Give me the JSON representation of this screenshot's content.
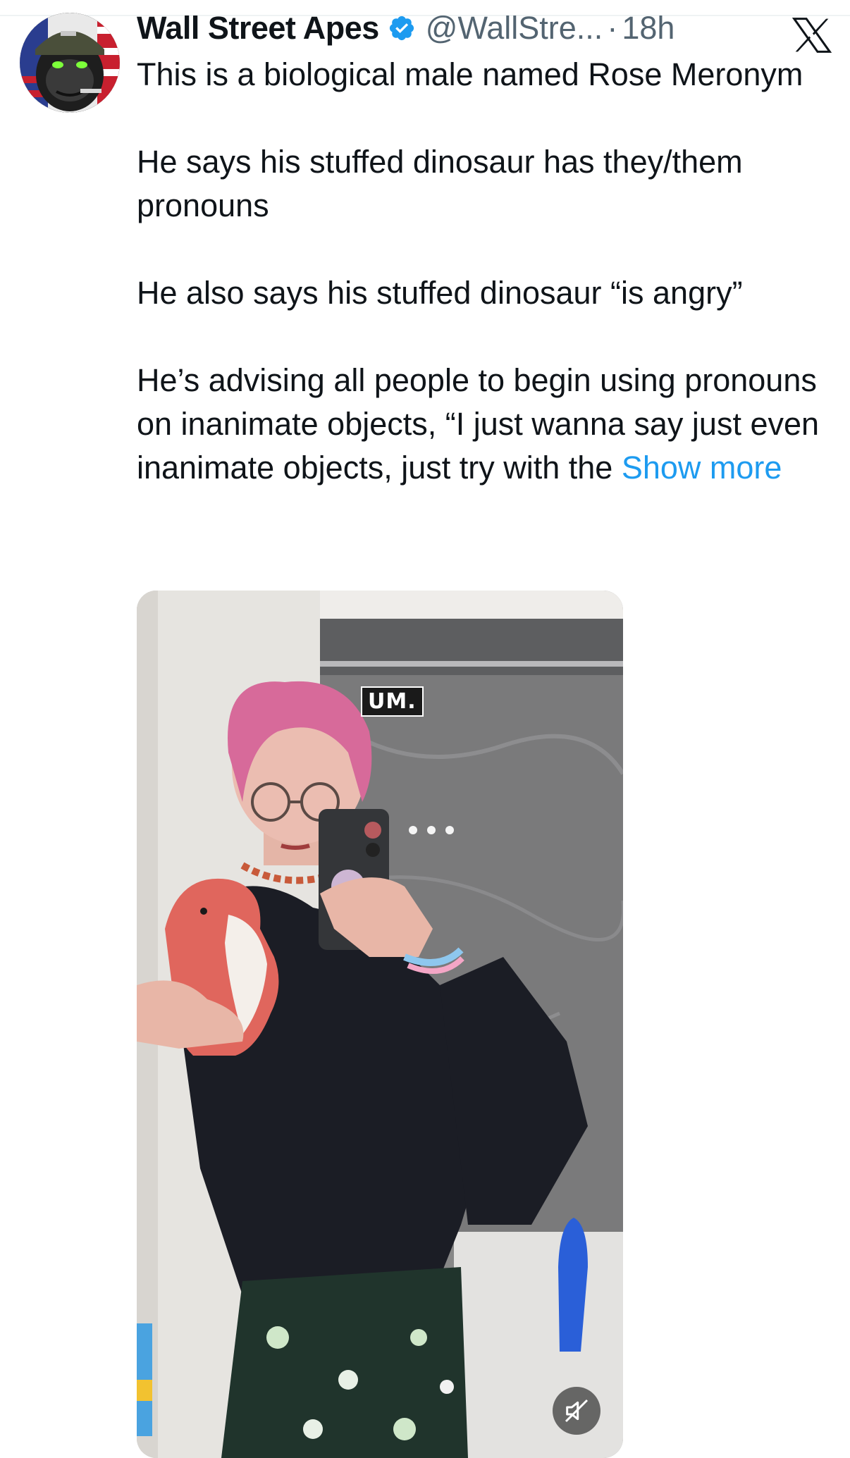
{
  "tweet": {
    "author": {
      "display_name": "Wall Street Apes",
      "handle": "@WallStre...",
      "verified": true
    },
    "separator": "·",
    "timestamp": "18h",
    "paragraphs": [
      "This is a biological male named Rose Meronym",
      "He says his stuffed dinosaur has they/them pronouns",
      "He also says his stuffed dinosaur “is angry”"
    ],
    "last_paragraph": "He’s advising all people to begin using pronouns on inanimate objects, “I just wanna say just even inanimate objects, just try with the",
    "show_more_label": "Show more"
  },
  "media": {
    "caption_text": "UM.",
    "mute_icon": "speaker-muted-icon"
  },
  "icons": {
    "platform_logo": "x-logo-icon",
    "verified": "verified-badge-icon"
  },
  "colors": {
    "link": "#1d9bf0",
    "verified": "#1d9bf0",
    "secondary_text": "#536471",
    "primary_text": "#0f1419"
  }
}
